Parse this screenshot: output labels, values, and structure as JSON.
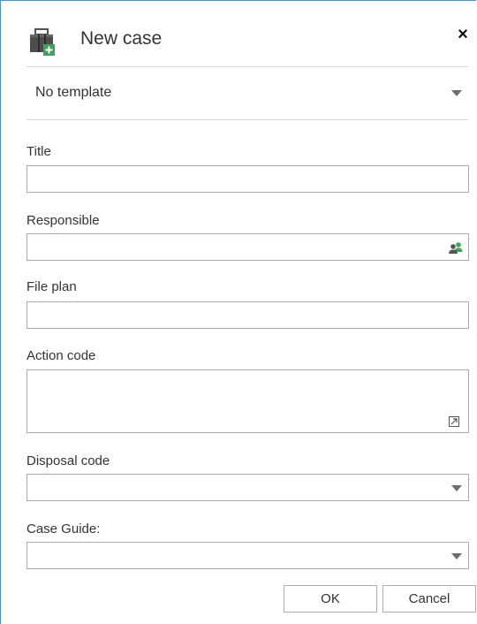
{
  "dialog": {
    "title": "New case",
    "close_label": "×",
    "icon": "case-icon"
  },
  "template": {
    "value": "No template",
    "icon": "chevron-down-icon"
  },
  "fields": {
    "title": {
      "label": "Title",
      "value": ""
    },
    "responsible": {
      "label": "Responsible",
      "value": "",
      "icon": "people-icon"
    },
    "file_plan": {
      "label": "File plan",
      "value": ""
    },
    "action_code": {
      "label": "Action code",
      "value": "",
      "icon": "expand-icon"
    },
    "disposal_code": {
      "label": "Disposal code",
      "value": ""
    },
    "case_guide": {
      "label": "Case Guide:",
      "value": ""
    }
  },
  "buttons": {
    "ok": "OK",
    "cancel": "Cancel"
  },
  "colors": {
    "accent_border": "#4a90d9",
    "input_border": "#aaaaaa",
    "icon_green": "#3fa15b"
  }
}
